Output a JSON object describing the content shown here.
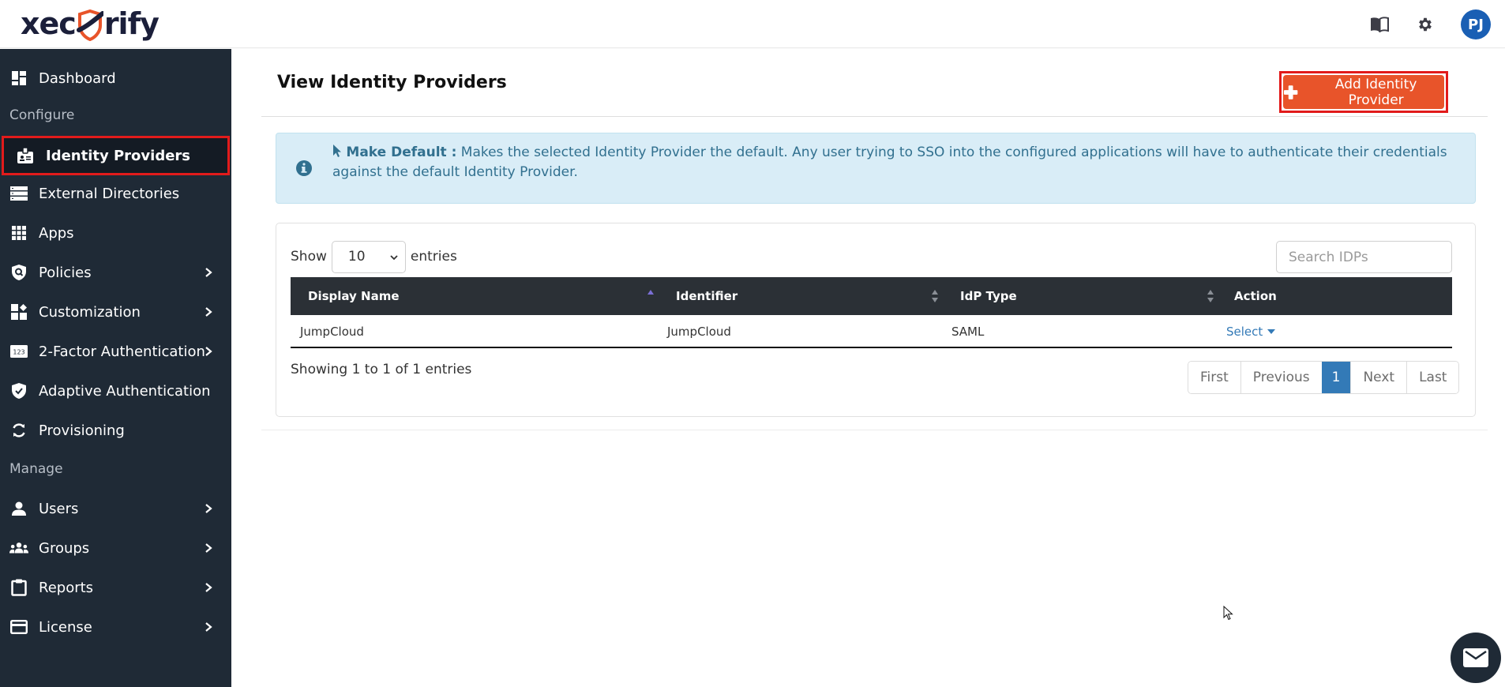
{
  "brand": {
    "logo_left": "xec",
    "logo_right": "rify",
    "accent": "#e8542a",
    "sidebar_bg": "#1f2a36"
  },
  "topbar": {
    "avatar_initials": "PJ",
    "icons": [
      "book-icon",
      "gear-icon"
    ]
  },
  "sidebar": {
    "items": [
      {
        "label": "Dashboard",
        "icon": "dashboard-icon",
        "has_submenu": false
      },
      {
        "section": "Configure"
      },
      {
        "label": "Identity Providers",
        "icon": "id-badge-icon",
        "has_submenu": false,
        "active": true
      },
      {
        "label": "External Directories",
        "icon": "server-icon",
        "has_submenu": false
      },
      {
        "label": "Apps",
        "icon": "grid-icon",
        "has_submenu": false
      },
      {
        "label": "Policies",
        "icon": "shield-search-icon",
        "has_submenu": true
      },
      {
        "label": "Customization",
        "icon": "widgets-icon",
        "has_submenu": true
      },
      {
        "label": "2-Factor Authentication",
        "icon": "123-icon",
        "has_submenu": true
      },
      {
        "label": "Adaptive Authentication",
        "icon": "shield-check-icon",
        "has_submenu": false
      },
      {
        "label": "Provisioning",
        "icon": "sync-icon",
        "has_submenu": false
      },
      {
        "section": "Manage"
      },
      {
        "label": "Users",
        "icon": "user-icon",
        "has_submenu": true
      },
      {
        "label": "Groups",
        "icon": "users-icon",
        "has_submenu": true
      },
      {
        "label": "Reports",
        "icon": "clipboard-icon",
        "has_submenu": true
      },
      {
        "label": "License",
        "icon": "card-icon",
        "has_submenu": true
      }
    ]
  },
  "main": {
    "title": "View Identity Providers",
    "add_button": "Add Identity Provider",
    "info": {
      "bold": "Make Default :",
      "text": " Makes the selected Identity Provider the default. Any user trying to SSO into the configured applications will have to authenticate their credentials against the default Identity Provider."
    },
    "show_label": "Show",
    "page_size": "10",
    "entries_label": "entries",
    "search_placeholder": "Search IDPs",
    "columns": [
      "Display Name",
      "Identifier",
      "IdP Type",
      "Action"
    ],
    "rows": [
      {
        "display_name": "JumpCloud",
        "identifier": "JumpCloud",
        "idp_type": "SAML",
        "action": "Select"
      }
    ],
    "showing": "Showing 1 to 1 of 1 entries",
    "pagination": [
      "First",
      "Previous",
      "1",
      "Next",
      "Last"
    ],
    "current_page": "1"
  }
}
